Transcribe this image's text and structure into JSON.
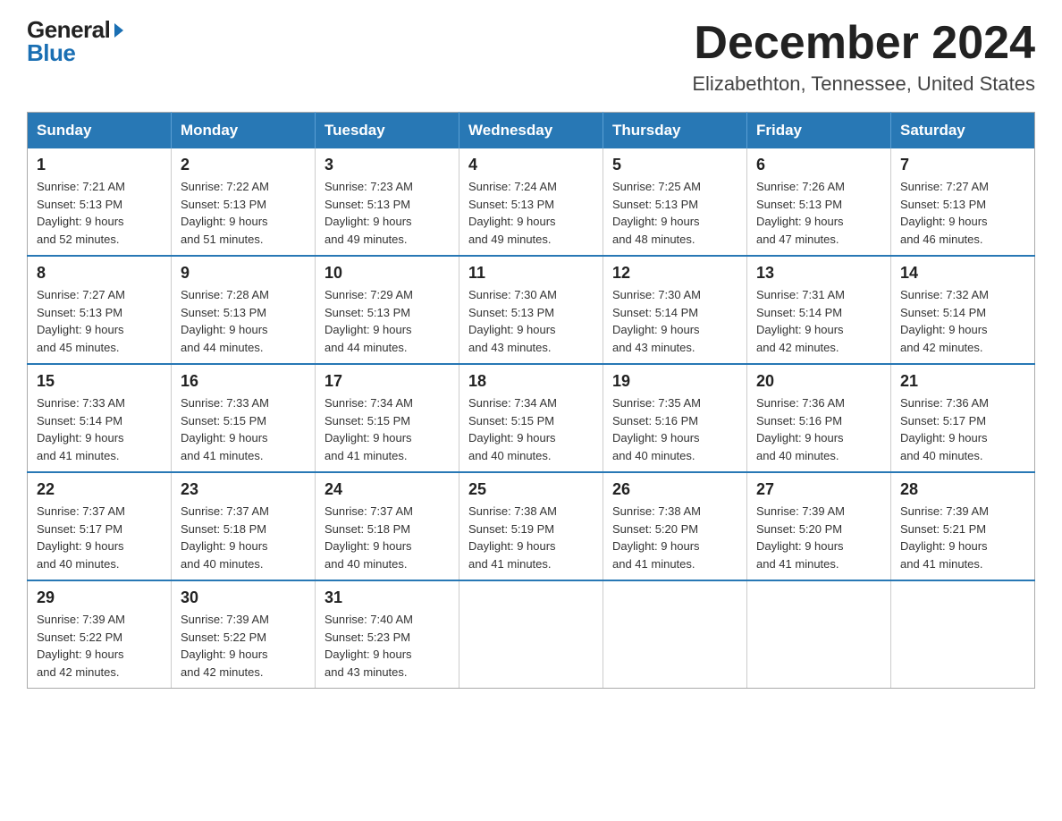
{
  "logo": {
    "general": "General",
    "blue": "Blue"
  },
  "title": "December 2024",
  "subtitle": "Elizabethton, Tennessee, United States",
  "weekdays": [
    "Sunday",
    "Monday",
    "Tuesday",
    "Wednesday",
    "Thursday",
    "Friday",
    "Saturday"
  ],
  "weeks": [
    [
      {
        "day": "1",
        "sunrise": "7:21 AM",
        "sunset": "5:13 PM",
        "daylight": "9 hours and 52 minutes."
      },
      {
        "day": "2",
        "sunrise": "7:22 AM",
        "sunset": "5:13 PM",
        "daylight": "9 hours and 51 minutes."
      },
      {
        "day": "3",
        "sunrise": "7:23 AM",
        "sunset": "5:13 PM",
        "daylight": "9 hours and 49 minutes."
      },
      {
        "day": "4",
        "sunrise": "7:24 AM",
        "sunset": "5:13 PM",
        "daylight": "9 hours and 49 minutes."
      },
      {
        "day": "5",
        "sunrise": "7:25 AM",
        "sunset": "5:13 PM",
        "daylight": "9 hours and 48 minutes."
      },
      {
        "day": "6",
        "sunrise": "7:26 AM",
        "sunset": "5:13 PM",
        "daylight": "9 hours and 47 minutes."
      },
      {
        "day": "7",
        "sunrise": "7:27 AM",
        "sunset": "5:13 PM",
        "daylight": "9 hours and 46 minutes."
      }
    ],
    [
      {
        "day": "8",
        "sunrise": "7:27 AM",
        "sunset": "5:13 PM",
        "daylight": "9 hours and 45 minutes."
      },
      {
        "day": "9",
        "sunrise": "7:28 AM",
        "sunset": "5:13 PM",
        "daylight": "9 hours and 44 minutes."
      },
      {
        "day": "10",
        "sunrise": "7:29 AM",
        "sunset": "5:13 PM",
        "daylight": "9 hours and 44 minutes."
      },
      {
        "day": "11",
        "sunrise": "7:30 AM",
        "sunset": "5:13 PM",
        "daylight": "9 hours and 43 minutes."
      },
      {
        "day": "12",
        "sunrise": "7:30 AM",
        "sunset": "5:14 PM",
        "daylight": "9 hours and 43 minutes."
      },
      {
        "day": "13",
        "sunrise": "7:31 AM",
        "sunset": "5:14 PM",
        "daylight": "9 hours and 42 minutes."
      },
      {
        "day": "14",
        "sunrise": "7:32 AM",
        "sunset": "5:14 PM",
        "daylight": "9 hours and 42 minutes."
      }
    ],
    [
      {
        "day": "15",
        "sunrise": "7:33 AM",
        "sunset": "5:14 PM",
        "daylight": "9 hours and 41 minutes."
      },
      {
        "day": "16",
        "sunrise": "7:33 AM",
        "sunset": "5:15 PM",
        "daylight": "9 hours and 41 minutes."
      },
      {
        "day": "17",
        "sunrise": "7:34 AM",
        "sunset": "5:15 PM",
        "daylight": "9 hours and 41 minutes."
      },
      {
        "day": "18",
        "sunrise": "7:34 AM",
        "sunset": "5:15 PM",
        "daylight": "9 hours and 40 minutes."
      },
      {
        "day": "19",
        "sunrise": "7:35 AM",
        "sunset": "5:16 PM",
        "daylight": "9 hours and 40 minutes."
      },
      {
        "day": "20",
        "sunrise": "7:36 AM",
        "sunset": "5:16 PM",
        "daylight": "9 hours and 40 minutes."
      },
      {
        "day": "21",
        "sunrise": "7:36 AM",
        "sunset": "5:17 PM",
        "daylight": "9 hours and 40 minutes."
      }
    ],
    [
      {
        "day": "22",
        "sunrise": "7:37 AM",
        "sunset": "5:17 PM",
        "daylight": "9 hours and 40 minutes."
      },
      {
        "day": "23",
        "sunrise": "7:37 AM",
        "sunset": "5:18 PM",
        "daylight": "9 hours and 40 minutes."
      },
      {
        "day": "24",
        "sunrise": "7:37 AM",
        "sunset": "5:18 PM",
        "daylight": "9 hours and 40 minutes."
      },
      {
        "day": "25",
        "sunrise": "7:38 AM",
        "sunset": "5:19 PM",
        "daylight": "9 hours and 41 minutes."
      },
      {
        "day": "26",
        "sunrise": "7:38 AM",
        "sunset": "5:20 PM",
        "daylight": "9 hours and 41 minutes."
      },
      {
        "day": "27",
        "sunrise": "7:39 AM",
        "sunset": "5:20 PM",
        "daylight": "9 hours and 41 minutes."
      },
      {
        "day": "28",
        "sunrise": "7:39 AM",
        "sunset": "5:21 PM",
        "daylight": "9 hours and 41 minutes."
      }
    ],
    [
      {
        "day": "29",
        "sunrise": "7:39 AM",
        "sunset": "5:22 PM",
        "daylight": "9 hours and 42 minutes."
      },
      {
        "day": "30",
        "sunrise": "7:39 AM",
        "sunset": "5:22 PM",
        "daylight": "9 hours and 42 minutes."
      },
      {
        "day": "31",
        "sunrise": "7:40 AM",
        "sunset": "5:23 PM",
        "daylight": "9 hours and 43 minutes."
      },
      null,
      null,
      null,
      null
    ]
  ],
  "labels": {
    "sunrise": "Sunrise:",
    "sunset": "Sunset:",
    "daylight": "Daylight:"
  }
}
